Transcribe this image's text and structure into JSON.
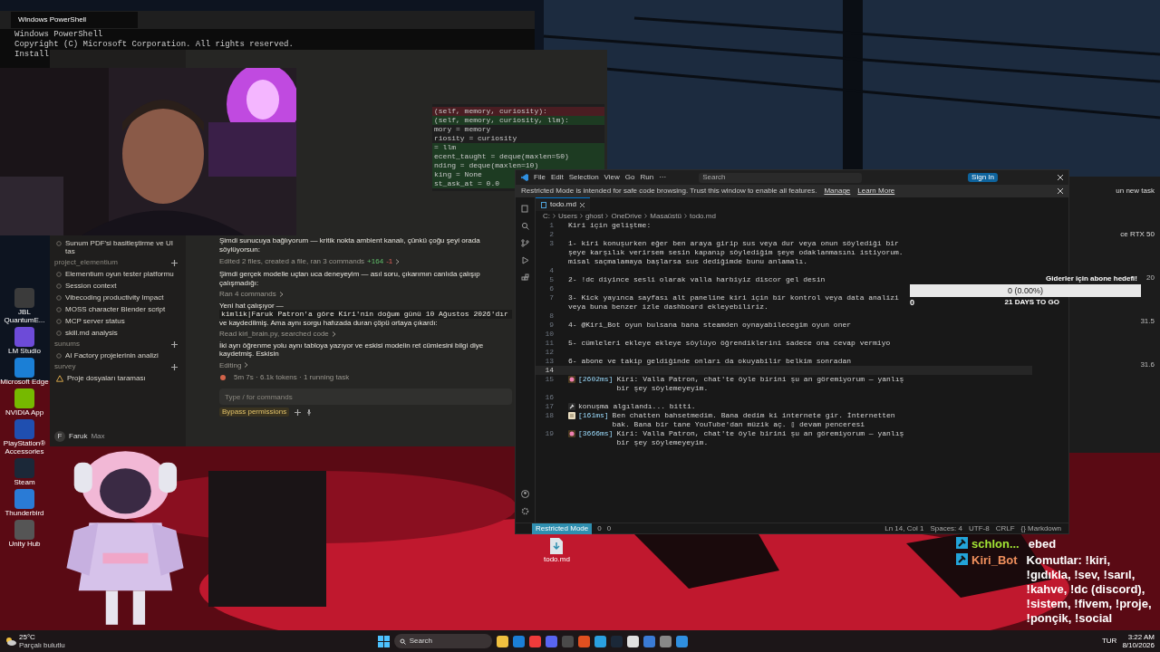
{
  "desktop_icons": [
    {
      "label": "JBL QuantumE..."
    },
    {
      "label": "LM Studio"
    },
    {
      "label": "Microsoft Edge"
    },
    {
      "label": "NVIDIA App"
    },
    {
      "label": "PlayStation® Accessories"
    },
    {
      "label": "Steam"
    },
    {
      "label": "Thunderbird"
    },
    {
      "label": "Unity Hub"
    }
  ],
  "powershell": {
    "title": "Windows PowerShell",
    "lines": [
      "Windows PowerShell",
      "Copyright (C) Microsoft Corporation. All rights reserved.",
      "Install"
    ]
  },
  "assistant": {
    "code_lines": [
      {
        "text": "(self, memory, curiosity):",
        "kind": "removed"
      },
      {
        "text": "(self, memory, curiosity, llm):",
        "kind": "added"
      },
      {
        "text": "mory = memory",
        "kind": "context"
      },
      {
        "text": "riosity = curiosity",
        "kind": "context"
      },
      {
        "text": "= llm",
        "kind": "added"
      },
      {
        "text": "ecent_taught = deque(maxlen=50)",
        "kind": "added"
      },
      {
        "text": "nding = deque(maxlen=10)",
        "kind": "added"
      },
      {
        "text": "king = None",
        "kind": "added"
      },
      {
        "text": "st_ask_at = 0.0",
        "kind": "added"
      }
    ],
    "sidebar": [
      {
        "items": [
          {
            "label": "Sunum PDF'si basitleştirme ve UI tas",
            "warning": false
          }
        ]
      },
      {
        "heading": "project_elementium",
        "items": [
          {
            "label": "Elementium oyun tester platformu",
            "warning": false
          },
          {
            "label": "Session context",
            "warning": false
          },
          {
            "label": "Vibecoding productivity Impact",
            "warning": false
          },
          {
            "label": "MOSS character Blender script",
            "warning": false
          },
          {
            "label": "MCP server status",
            "warning": false
          },
          {
            "label": "skill.md analysis",
            "warning": false
          }
        ]
      },
      {
        "heading": "sunums",
        "items": [
          {
            "label": "AI Factory projelerinin analizi",
            "warning": false
          }
        ]
      },
      {
        "heading": "survey",
        "items": [
          {
            "label": "Proje dosyaları taraması",
            "warning": true
          }
        ]
      }
    ],
    "user": {
      "initial": "F",
      "name": "Faruk",
      "plan": "Max"
    },
    "messages": [
      {
        "kind": "text",
        "text": "Şimdi sunucuya bağlıyorum — kritik nokta ambient kanalı, çünkü çoğu şeyi orada söylüyorsun:"
      },
      {
        "kind": "tool",
        "text": "Edited 2 files, created a file, ran 3 commands",
        "added": "+164",
        "removed": "-1"
      },
      {
        "kind": "text",
        "text": "Şimdi gerçek modelle uçtan uca deneyeyim — asıl soru, çıkarımın canlıda çalışıp çalışmadığı:"
      },
      {
        "kind": "tool",
        "text": "Ran 4 commands"
      },
      {
        "kind": "code_text",
        "text": "Yeni hat çalışıyor —",
        "code": "kimlik|Faruk Patron'a göre Kiri'nin doğum günü 10 Ağustos 2026'dır",
        "after": "ve kaydedilmiş. Ama aynı sorgu hafızada duran çöpü ortaya çıkardı:"
      },
      {
        "kind": "tool",
        "text": "Read kiri_brain.py, searched code"
      },
      {
        "kind": "text",
        "text": "İki ayrı öğrenme yolu aynı tabloya yazıyor ve eskisi modelin ret cümlesini bilgi diye kaydetmiş. Eskisin"
      },
      {
        "kind": "tool",
        "text": "Editing"
      }
    ],
    "status": "5m 7s · 6.1k tokens · 1 running task",
    "input": {
      "placeholder": "Type / for commands"
    },
    "mode": "Bypass permissions"
  },
  "editor": {
    "menu": [
      "File",
      "Edit",
      "Selection",
      "View",
      "Go",
      "Run",
      "···"
    ],
    "search": "Search",
    "sign_in": "Sign In",
    "banner": {
      "text": "Restricted Mode is intended for safe code browsing. Trust this window to enable all features.",
      "links": [
        "Manage",
        "Learn More"
      ]
    },
    "tab": "todo.md",
    "breadcrumb": [
      "C:",
      "Users",
      "ghost",
      "OneDrive",
      "Masaüstü",
      "todo.md"
    ],
    "lines": [
      {
        "n": "1",
        "kind": "plain",
        "text": "Kiri için geliştme:",
        "current": false
      },
      {
        "n": "2",
        "kind": "plain",
        "current": false
      },
      {
        "n": "3",
        "kind": "plain",
        "text": "1- kiri konuşurken eğer ben araya girip sus veya dur veya onun söylediği bir şeye karşılık verirsem sesin kapanıp söylediğim şeye odaklanmasını istiyorum. misal saçmalamaya başlarsa sus dediğimde bunu anlamalı.",
        "current": false
      },
      {
        "n": "4",
        "kind": "plain",
        "current": false
      },
      {
        "n": "5",
        "kind": "plain",
        "text": "2-  !dc diyince sesli olarak valla harbiyiz discor gel desin",
        "current": false
      },
      {
        "n": "6",
        "kind": "plain",
        "current": false
      },
      {
        "n": "7",
        "kind": "plain",
        "text": "3- Kick yayınca sayfası alt paneline kiri için bir kontrol veya data analizi veya buna benzer izle dashboard ekleyebiliriz.",
        "current": false
      },
      {
        "n": "8",
        "kind": "plain",
        "current": false
      },
      {
        "n": "9",
        "kind": "plain",
        "text": "4-  @Kiri_Bot oyun bulsana bana steamden oynayabilecegim oyun oner",
        "current": false
      },
      {
        "n": "10",
        "kind": "plain",
        "current": false
      },
      {
        "n": "11",
        "kind": "plain",
        "text": "5-  cümleleri ekleye ekleye söylüyo öğrendiklerini sadece ona cevap vermiyo",
        "current": false
      },
      {
        "n": "12",
        "kind": "plain",
        "current": false
      },
      {
        "n": "13",
        "kind": "plain",
        "text": "6- abone ve takip geldiğinde onları da okuyabilir belkim sonradan",
        "current": false
      },
      {
        "n": "14",
        "kind": "plain",
        "current": true
      },
      {
        "n": "15",
        "kind": "reply",
        "time": "[2602ms]",
        "text": "Kiri: Valla Patron, chat'te öyle birini şu an göremiyorum — yanlış bir şey söylemeyeyim.",
        "current": false
      },
      {
        "n": "16",
        "kind": "plain",
        "current": false
      },
      {
        "n": "17",
        "kind": "event",
        "text": "konuşma algılandı... bitti.",
        "current": false
      },
      {
        "n": "18",
        "kind": "transcript",
        "time": "[161ms]",
        "text": "Ben chatten bahsetmedim. Bana dedim ki internete gir. İnternetten bak. Bana bir tane YouTube'dan müzik aç.   ▯ devam penceresi",
        "current": false
      },
      {
        "n": "19",
        "kind": "reply",
        "time": "[3666ms]",
        "text": "Kiri: Valla Patron, chat'te öyle birini şu an göremiyorum — yanlış bir şey söylemeyeyim.",
        "current": false
      }
    ],
    "status": {
      "mode": "Restricted Mode",
      "errors": "0",
      "warnings": "0",
      "right": [
        "Ln 14, Col 1",
        "Spaces: 4",
        "UTF-8",
        "CRLF",
        "{} Markdown"
      ]
    }
  },
  "goal": {
    "title": "Giderler için abone hedefi!",
    "value": "0 (0.00%)",
    "start": "0",
    "remaining": "21 DAYS TO GO"
  },
  "right_window": {
    "lines": [
      "un new task",
      "ce RTX 50"
    ],
    "axis": [
      "20",
      "31.5",
      "31.6"
    ]
  },
  "file_icon": {
    "label": "todo.md"
  },
  "chat": [
    {
      "user": "schlon...",
      "color": "#a3e635",
      "text": "ebed"
    },
    {
      "user": "Kiri_Bot",
      "color": "#f0905d",
      "text": "Komutlar: !kiri, !gıdıkla, !sev, !sarıl, !kahve, !dc (discord), !sistem, !fivem, !proje, !ponçik, !social"
    }
  ],
  "taskbar": {
    "temperature": "25°C",
    "weather": "Parçalı bulutlu",
    "search": "Search",
    "language": "TUR",
    "time": "3:22 AM",
    "date": "8/10/2026"
  }
}
